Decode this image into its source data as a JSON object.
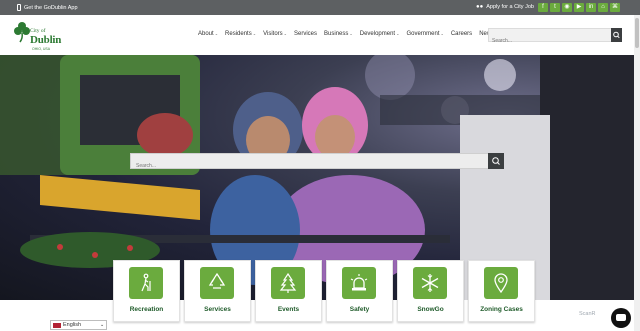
{
  "topbar": {
    "app_label": "Get the GoDublin App",
    "job_label": "Apply for a City Job",
    "social_icons": [
      "facebook-icon",
      "twitter-icon",
      "instagram-icon",
      "youtube-icon",
      "linkedin-icon",
      "nextdoor-icon",
      "rss-icon"
    ]
  },
  "logo": {
    "line1": "City of",
    "line2": "Dublin",
    "line3": "OHIO, USA"
  },
  "nav": {
    "items": [
      {
        "label": "About",
        "dropdown": true
      },
      {
        "label": "Residents",
        "dropdown": true
      },
      {
        "label": "Visitors",
        "dropdown": true
      },
      {
        "label": "Services",
        "dropdown": false
      },
      {
        "label": "Business",
        "dropdown": true
      },
      {
        "label": "Development",
        "dropdown": true
      },
      {
        "label": "Government",
        "dropdown": true
      },
      {
        "label": "Careers",
        "dropdown": false
      },
      {
        "label": "News",
        "dropdown": false
      }
    ]
  },
  "header_search": {
    "placeholder": "Search..."
  },
  "hero_search": {
    "placeholder": "Search..."
  },
  "tiles": [
    {
      "label": "Recreation",
      "icon": "hiking-icon"
    },
    {
      "label": "Services",
      "icon": "recycle-icon"
    },
    {
      "label": "Events",
      "icon": "tree-icon"
    },
    {
      "label": "Safety",
      "icon": "siren-icon"
    },
    {
      "label": "SnowGo",
      "icon": "snowflake-icon"
    },
    {
      "label": "Zoning Cases",
      "icon": "map-pin-icon"
    }
  ],
  "language": {
    "selected": "English"
  },
  "badge": "ScanR",
  "colors": {
    "accent": "#6bab3e",
    "topbar": "#5d6062",
    "dark": "#3b3e40",
    "brand_green": "#2d7a33"
  }
}
